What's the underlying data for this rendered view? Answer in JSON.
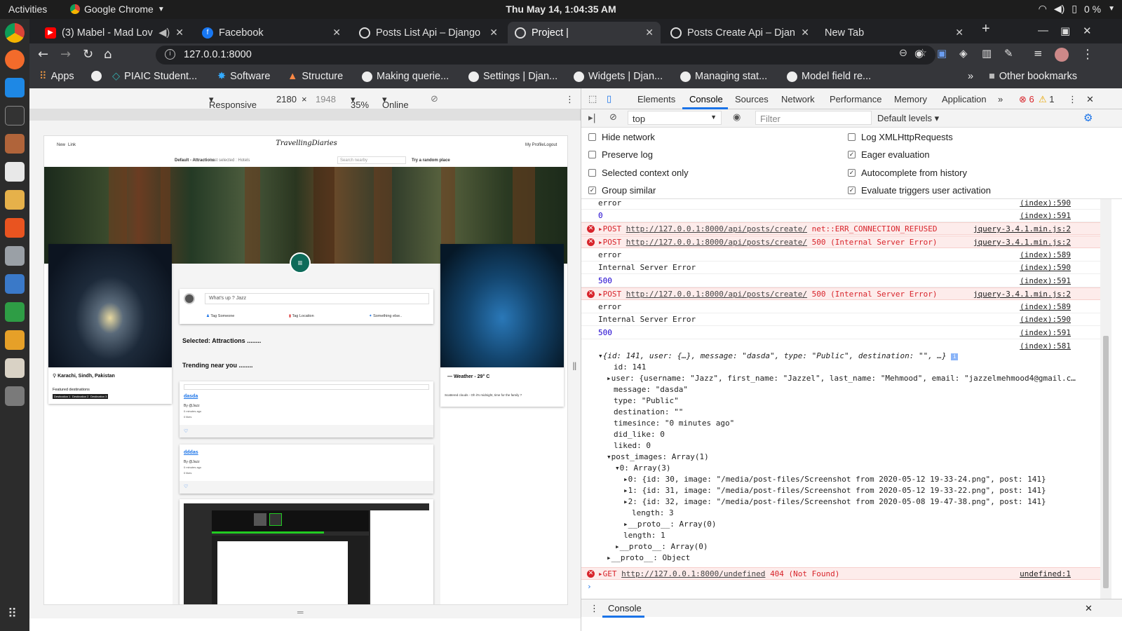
{
  "topbar": {
    "activities": "Activities",
    "app_name": "Google Chrome",
    "clock": "Thu May 14,  1:04:35 AM",
    "battery": "0 %"
  },
  "tabs": [
    {
      "title": "(3) Mabel - Mad Love",
      "favicon": "youtube-icon",
      "color": "#ff0000"
    },
    {
      "title": "Facebook",
      "favicon": "facebook-icon",
      "color": "#1877f2"
    },
    {
      "title": "Posts List Api – Django R",
      "favicon": "globe-icon",
      "color": "#ffffff"
    },
    {
      "title": "Project |",
      "favicon": "globe-icon",
      "color": "#ffffff"
    },
    {
      "title": "Posts Create Api – Djang",
      "favicon": "globe-icon",
      "color": "#ffffff"
    },
    {
      "title": "New Tab",
      "favicon": "",
      "color": ""
    }
  ],
  "address": "127.0.0.1:8000",
  "bookmarks": [
    "Apps",
    "",
    "PIAIC Student...",
    "Software",
    "Structure",
    "Making querie...",
    "Settings | Djan...",
    "Widgets | Djan...",
    "Managing stat...",
    "Model field re..."
  ],
  "other_bookmarks": "Other bookmarks",
  "device": {
    "mode": "Responsive",
    "width": "2180",
    "height": "1948",
    "zoom": "35%",
    "network": "Online"
  },
  "site": {
    "nav_left": [
      "New",
      "Link"
    ],
    "brand": "TravellingDiaries",
    "nav_right": [
      "My Profile",
      "Logout"
    ],
    "filter_default": "Default - Attractions",
    "filter_last": "Last selected : Hotels",
    "search_placeholder": "Search nearby",
    "random": "Try a random place",
    "post_placeholder": "What's up ? Jazz",
    "actions": [
      "Tag Someone",
      "Tag Location",
      "Something else.."
    ],
    "selected": "Selected: Attractions ........",
    "trending": "Trending near you ........",
    "location": "Karachi, Sindh, Pakistan",
    "featured": "Featured destinations",
    "destinations": [
      "Destination 1",
      "Destination 2",
      "Destination 3"
    ],
    "weather": "Weather - 29° C",
    "weather_desc": "Scattered clouds - Oh it's midnight, time for the family ?",
    "posts": [
      {
        "title": "dasda",
        "by": "By @Jazz",
        "meta1": "0 minutes ago",
        "meta2": "0 likes"
      },
      {
        "title": "dddas",
        "by": "By @Jazz",
        "meta1": "0 minutes ago",
        "meta2": "0 likes"
      }
    ]
  },
  "devtools": {
    "tabs": [
      "Elements",
      "Console",
      "Sources",
      "Network",
      "Performance",
      "Memory",
      "Application"
    ],
    "errors": "6",
    "warnings": "1",
    "context": "top",
    "filter_placeholder": "Filter",
    "levels": "Default levels",
    "options_left": [
      {
        "label": "Hide network",
        "checked": false
      },
      {
        "label": "Preserve log",
        "checked": false
      },
      {
        "label": "Selected context only",
        "checked": false
      },
      {
        "label": "Group similar",
        "checked": true
      }
    ],
    "options_right": [
      {
        "label": "Log XMLHttpRequests",
        "checked": false
      },
      {
        "label": "Eager evaluation",
        "checked": true
      },
      {
        "label": "Autocomplete from history",
        "checked": true
      },
      {
        "label": "Evaluate triggers user activation",
        "checked": true
      }
    ],
    "log": [
      {
        "type": "log",
        "text": "error",
        "src": "(index):590"
      },
      {
        "type": "log",
        "text": "0",
        "src": "(index):591",
        "num": true
      },
      {
        "type": "err",
        "method": "POST",
        "url": "http://127.0.0.1:8000/api/posts/create/",
        "msg": "net::ERR_CONNECTION_REFUSED",
        "src": "jquery-3.4.1.min.js:2"
      },
      {
        "type": "err",
        "method": "POST",
        "url": "http://127.0.0.1:8000/api/posts/create/",
        "msg": "500 (Internal Server Error)",
        "src": "jquery-3.4.1.min.js:2"
      },
      {
        "type": "log",
        "text": "error",
        "src": "(index):589"
      },
      {
        "type": "log",
        "text": "Internal Server Error",
        "src": "(index):590"
      },
      {
        "type": "log",
        "text": "500",
        "src": "(index):591",
        "num": true
      },
      {
        "type": "err",
        "method": "POST",
        "url": "http://127.0.0.1:8000/api/posts/create/",
        "msg": "500 (Internal Server Error)",
        "src": "jquery-3.4.1.min.js:2"
      },
      {
        "type": "log",
        "text": "error",
        "src": "(index):589"
      },
      {
        "type": "log",
        "text": "Internal Server Error",
        "src": "(index):590"
      },
      {
        "type": "log",
        "text": "500",
        "src": "(index):591",
        "num": true
      },
      {
        "type": "log",
        "text": "",
        "src": "(index):581"
      }
    ],
    "object_summary": "{id: 141, user: {…}, message: \"dasda\", type: \"Public\", destination: \"\", …}",
    "object_lines": [
      "id: 141",
      "user: {username: \"Jazz\", first_name: \"Jazzel\", last_name: \"Mehmood\", email: \"jazzelmehmood4@gmail.c…",
      "message: \"dasda\"",
      "type: \"Public\"",
      "destination: \"\"",
      "timesince: \"0 minutes ago\"",
      "did_like: 0",
      "liked: 0",
      "post_images: Array(1)",
      "0: Array(3)",
      "0: {id: 30, image: \"/media/post-files/Screenshot from 2020-05-12 19-33-24.png\", post: 141}",
      "1: {id: 31, image: \"/media/post-files/Screenshot from 2020-05-12 19-33-22.png\", post: 141}",
      "2: {id: 32, image: \"/media/post-files/Screenshot from 2020-05-08 19-47-38.png\", post: 141}",
      "length: 3",
      "__proto__: Array(0)",
      "length: 1",
      "__proto__: Array(0)",
      "__proto__: Object"
    ],
    "last_error": {
      "method": "GET",
      "url": "http://127.0.0.1:8000/undefined",
      "msg": "404 (Not Found)",
      "src": "undefined:1"
    },
    "drawer": "Console"
  }
}
